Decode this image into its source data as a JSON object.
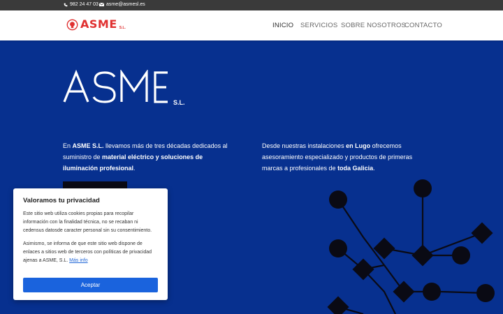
{
  "topbar": {
    "phone": "982 24 47 03",
    "email": "asme@asmesl.es"
  },
  "header": {
    "logo_text": "ASME",
    "logo_suffix": "S.L."
  },
  "nav": {
    "items": [
      {
        "label": "INICIO",
        "active": true
      },
      {
        "label": "SERVICIOS",
        "active": false
      },
      {
        "label": "SOBRE NOSOTROS",
        "active": false
      },
      {
        "label": "CONTACTO",
        "active": false
      }
    ]
  },
  "hero": {
    "logo_text": "ASME",
    "logo_suffix": "S.L.",
    "left": {
      "p1": "En ",
      "b1": "ASME S.L.",
      "p2": " llevamos más de tres décadas dedicados al suministro de ",
      "b2": "material eléctrico y soluciones de iluminación profesional",
      "p3": "."
    },
    "right": {
      "p1": "Desde nuestras instalaciones ",
      "b1": "en Lugo",
      "p2": " ofrecemos asesoramiento especializado y productos de primeras marcas a profesionales de ",
      "b2": "toda Galicia",
      "p3": "."
    }
  },
  "cookie": {
    "title": "Valoramos tu privacidad",
    "text1": "Este sitio web utiliza cookies propias para recopilar información con la finalidad técnica, no se recaban ni cedensus datosde caracter personal sin su consentimiento.",
    "text2": "Asimismo, se informa de que este sitio web dispone de enlaces a sitios web de terceros con políticas de privacidad ajenas a ASME, S.L. ",
    "link": "Más info",
    "accept": "Aceptar"
  },
  "colors": {
    "brand_red": "#e03030",
    "hero_blue": "#07308f",
    "accept_blue": "#1a63dd"
  }
}
